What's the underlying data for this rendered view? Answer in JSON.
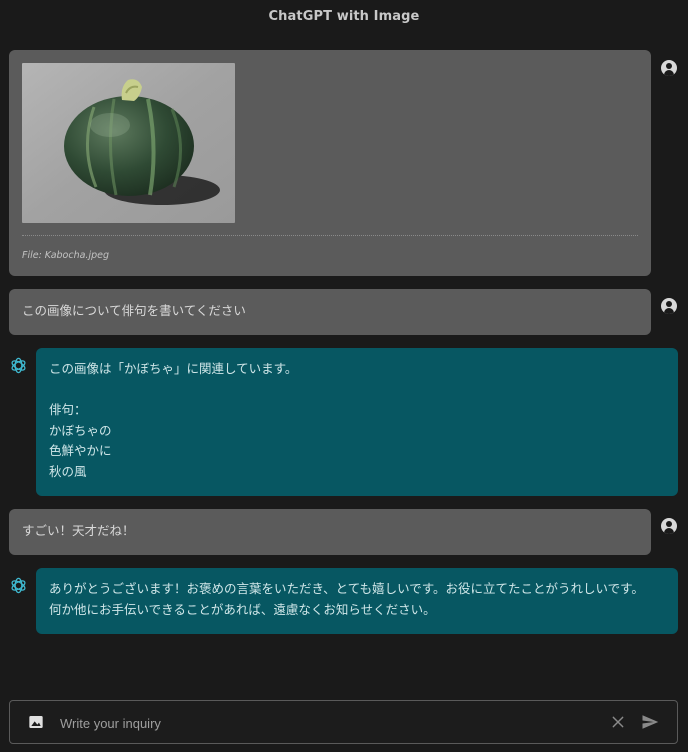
{
  "app": {
    "title": "ChatGPT with Image"
  },
  "messages": [
    {
      "role": "user",
      "kind": "image",
      "file_caption": "File: Kabocha.jpeg"
    },
    {
      "role": "user",
      "kind": "text",
      "text": "この画像について俳句を書いてください"
    },
    {
      "role": "assistant",
      "kind": "text",
      "text": "この画像は「かぼちゃ」に関連しています。\n\n俳句：\nかぼちゃの\n色鮮やかに\n秋の風"
    },
    {
      "role": "user",
      "kind": "text",
      "text": "すごい！天才だね！"
    },
    {
      "role": "assistant",
      "kind": "text",
      "text": "ありがとうございます！お褒めの言葉をいただき、とても嬉しいです。お役に立てたことがうれしいです。\n何か他にお手伝いできることがあれば、遠慮なくお知らせください。"
    }
  ],
  "input": {
    "placeholder": "Write your inquiry",
    "value": ""
  },
  "icons": {
    "user_avatar": "account-circle-icon",
    "assistant_avatar": "openai-logo-icon",
    "attach_image": "image-icon",
    "clear": "close-icon",
    "send": "send-icon"
  },
  "colors": {
    "background": "#1a1a1a",
    "user_bubble": "#5b5b5b",
    "assistant_bubble": "#075762",
    "assistant_avatar": "#3fb9d0"
  }
}
